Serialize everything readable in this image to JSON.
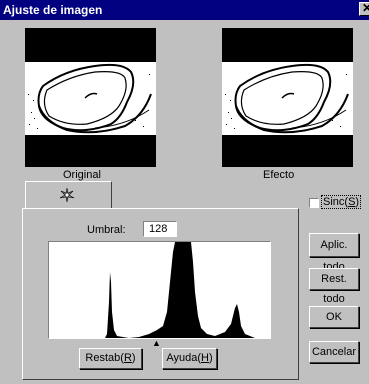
{
  "window": {
    "title": "Ajuste de imagen",
    "close_glyph": "✕"
  },
  "previews": {
    "original_label": "Original",
    "effect_label": "Efecto"
  },
  "tab": {
    "icon": "adjust-sparkle-icon"
  },
  "threshold": {
    "label": "Umbral:",
    "value": "128"
  },
  "sync": {
    "label_pre": "Sinc(",
    "label_key": "S",
    "label_post": ")",
    "checked": false
  },
  "buttons": {
    "apply_all": "Aplic. todo",
    "reset_all": "Rest. todo",
    "ok": "OK",
    "cancel": "Cancelar",
    "restore_pre": "Restab(",
    "restore_key": "R",
    "restore_post": ")",
    "help_pre": "Ayuda(",
    "help_key": "H",
    "help_post": ")"
  },
  "histogram": {
    "marker": "▲"
  },
  "colors": {
    "titlebar": "#000080",
    "face": "#c0c0c0"
  }
}
